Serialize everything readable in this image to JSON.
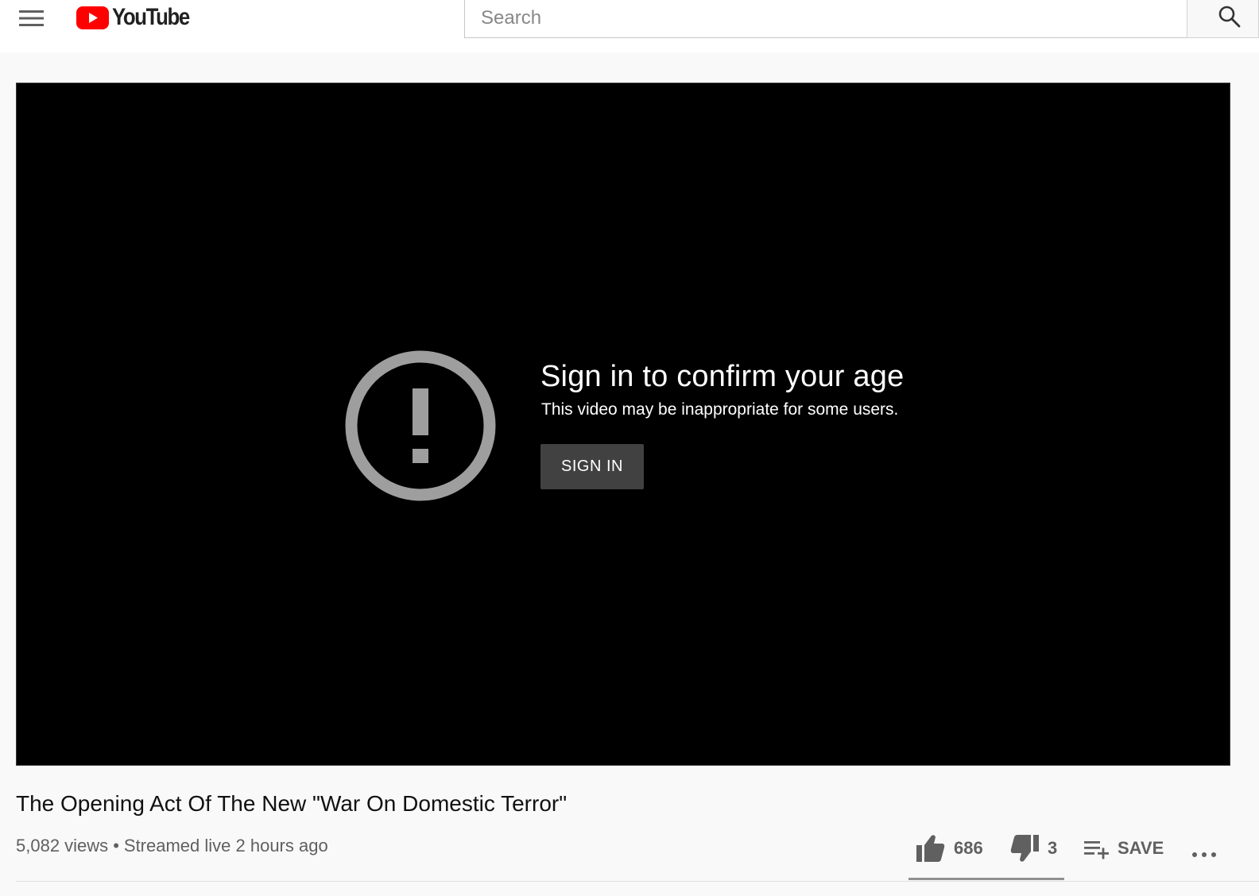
{
  "masthead": {
    "logo_text": "YouTube",
    "search": {
      "placeholder": "Search",
      "value": ""
    }
  },
  "player": {
    "age_gate": {
      "title": "Sign in to confirm your age",
      "subtitle": "This video may be inappropriate for some users.",
      "signin_label": "SIGN IN"
    },
    "icon": "exclamation-circle-icon"
  },
  "video": {
    "title": "The Opening Act Of The New \"War On Domestic Terror\"",
    "views": "5,082 views",
    "separator": "•",
    "streamed": "Streamed live 2 hours ago",
    "likes": "686",
    "dislikes": "3",
    "save_label": "SAVE",
    "like_ratio": 0.996
  },
  "icons": {
    "menu": "hamburger-menu-icon",
    "logo": "youtube-logo-icon",
    "search": "search-icon",
    "like": "thumbs-up-icon",
    "dislike": "thumbs-down-icon",
    "save": "playlist-add-icon",
    "more": "more-horizontal-icon"
  },
  "colors": {
    "brand_red": "#ff0000",
    "player_bg": "#000000",
    "signin_button_bg": "#414141",
    "warn_icon": "#9e9e9e",
    "page_bg": "#f9f9f9",
    "action_gray": "#606060"
  }
}
